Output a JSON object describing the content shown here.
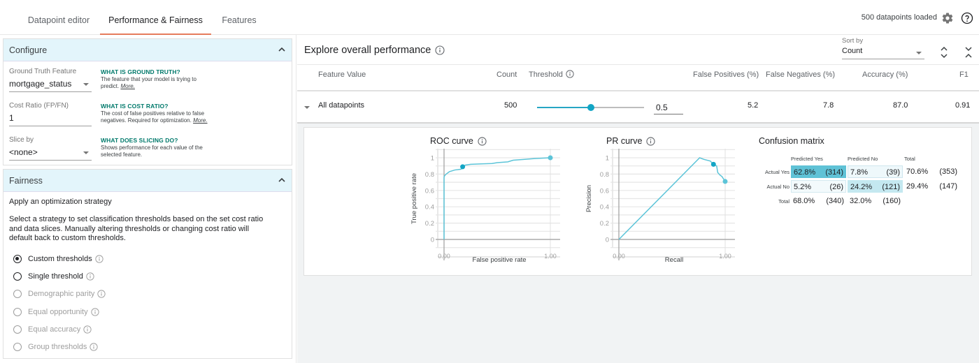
{
  "tabs": [
    {
      "label": "Datapoint editor",
      "active": false
    },
    {
      "label": "Performance & Fairness",
      "active": true
    },
    {
      "label": "Features",
      "active": false
    }
  ],
  "status": {
    "loaded_text": "500 datapoints loaded"
  },
  "icons": {
    "settings": "gear-icon",
    "help": "help-circle-icon",
    "info": "info-icon",
    "collapse": "chevron-up-icon"
  },
  "colors": {
    "accent": "#12a5c5",
    "tab_underline": "#e67c5c",
    "card_header": "#e3f5fb",
    "help_heading": "#00796b",
    "tp_cell": "#5fc2d6",
    "tn_cell": "#c4e8f0"
  },
  "configure": {
    "title": "Configure",
    "ground_truth": {
      "label": "Ground Truth Feature",
      "value": "mortgage_status",
      "help_title": "WHAT IS GROUND TRUTH?",
      "help_text": "The feature that your model is trying to predict.",
      "more": "More."
    },
    "cost_ratio": {
      "label": "Cost Ratio (FP/FN)",
      "value": "1",
      "help_title": "WHAT IS COST RATIO?",
      "help_text": "The cost of false positives relative to false negatives. Required for optimization.",
      "more": "More."
    },
    "slice_by": {
      "label": "Slice by",
      "value": "<none>",
      "help_title": "WHAT DOES SLICING DO?",
      "help_text": "Shows performance for each value of the selected feature."
    }
  },
  "fairness": {
    "title": "Fairness",
    "subtitle": "Apply an optimization strategy",
    "description": "Select a strategy to set classification thresholds based on the set cost ratio and data slices. Manually altering thresholds or changing cost ratio will default back to custom thresholds.",
    "strategies": [
      {
        "label": "Custom thresholds",
        "checked": true,
        "enabled": true
      },
      {
        "label": "Single threshold",
        "checked": false,
        "enabled": true
      },
      {
        "label": "Demographic parity",
        "checked": false,
        "enabled": false
      },
      {
        "label": "Equal opportunity",
        "checked": false,
        "enabled": false
      },
      {
        "label": "Equal accuracy",
        "checked": false,
        "enabled": false
      },
      {
        "label": "Group thresholds",
        "checked": false,
        "enabled": false
      }
    ]
  },
  "performance": {
    "title": "Explore overall performance",
    "sort": {
      "label": "Sort by",
      "value": "Count"
    },
    "columns": [
      "Feature Value",
      "Count",
      "Threshold",
      "False Positives (%)",
      "False Negatives (%)",
      "Accuracy (%)",
      "F1"
    ],
    "row": {
      "feature_value": "All datapoints",
      "count": "500",
      "threshold": 0.5,
      "threshold_text": "0.5",
      "false_positives": "5.2",
      "false_negatives": "7.8",
      "accuracy": "87.0",
      "f1": "0.91"
    }
  },
  "chart_data": [
    {
      "type": "line",
      "title": "ROC curve",
      "xlabel": "False positive rate",
      "ylabel": "True positive rate",
      "xlim": [
        0,
        1
      ],
      "ylim": [
        0,
        1
      ],
      "xticks": [
        "0.00",
        "1.00"
      ],
      "yticks": [
        "0",
        "0.2",
        "0.4",
        "0.6",
        "0.8",
        "1"
      ],
      "grid": true,
      "x": [
        0,
        0,
        0.005,
        0.02,
        0.05,
        0.1,
        0.16,
        0.175,
        0.2,
        0.25,
        0.35,
        0.45,
        0.5,
        0.6,
        0.65,
        0.75,
        0.85,
        1.0
      ],
      "y": [
        0,
        0.76,
        0.78,
        0.8,
        0.83,
        0.85,
        0.86,
        0.89,
        0.91,
        0.92,
        0.925,
        0.93,
        0.94,
        0.95,
        0.97,
        0.98,
        0.99,
        1.0
      ],
      "markers": [
        {
          "x": 0.175,
          "y": 0.89
        },
        {
          "x": 1.0,
          "y": 1.0
        }
      ]
    },
    {
      "type": "line",
      "title": "PR curve",
      "xlabel": "Recall",
      "ylabel": "Precision",
      "xlim": [
        0,
        1
      ],
      "ylim": [
        0,
        1
      ],
      "xticks": [
        "0.00",
        "1.00"
      ],
      "yticks": [
        "0",
        "0.2",
        "0.4",
        "0.6",
        "0.8",
        "1"
      ],
      "grid": true,
      "x": [
        0,
        0.76,
        0.8,
        0.86,
        0.89,
        0.92,
        0.93,
        0.95,
        0.97,
        1.0
      ],
      "y": [
        0,
        1.0,
        0.98,
        0.96,
        0.92,
        0.9,
        0.82,
        0.79,
        0.77,
        0.71
      ],
      "markers": [
        {
          "x": 0.89,
          "y": 0.92
        },
        {
          "x": 1.0,
          "y": 0.71
        }
      ]
    },
    {
      "type": "table",
      "title": "Confusion matrix",
      "col_headers": [
        "Predicted Yes",
        "Predicted No",
        "Total"
      ],
      "rows": [
        {
          "label": "Actual Yes",
          "cells": [
            [
              "62.8%",
              "(314)"
            ],
            [
              "7.8%",
              "(39)"
            ],
            [
              "70.6%",
              "(353)"
            ]
          ]
        },
        {
          "label": "Actual No",
          "cells": [
            [
              "5.2%",
              "(26)"
            ],
            [
              "24.2%",
              "(121)"
            ],
            [
              "29.4%",
              "(147)"
            ]
          ]
        },
        {
          "label": "Total",
          "cells": [
            [
              "68.0%",
              "(340)"
            ],
            [
              "32.0%",
              "(160)"
            ]
          ]
        }
      ]
    }
  ]
}
